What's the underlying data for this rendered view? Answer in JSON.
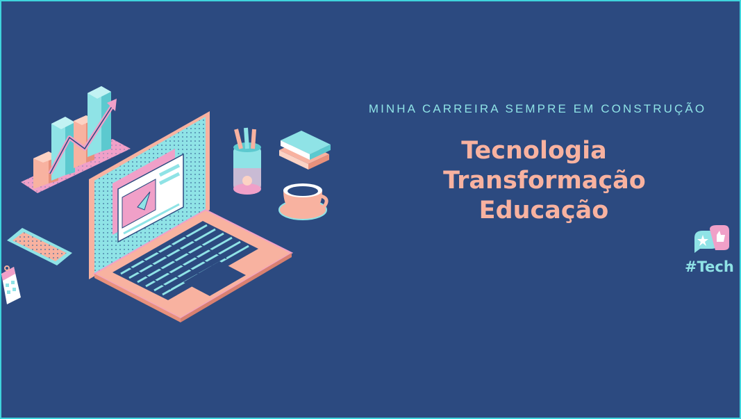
{
  "banner": {
    "tagline": "MINHA CARREIRA SEMPRE EM CONSTRUÇÃO",
    "headings": [
      "Tecnologia",
      "Transformação",
      "Educação"
    ],
    "hashtag": "#Tech"
  },
  "illustration": {
    "items": [
      "bar-chart-icon",
      "laptop-icon",
      "pencil-cup-icon",
      "books-icon",
      "coffee-cup-icon",
      "smartphone-icon",
      "calendar-icon",
      "like-star-icon"
    ]
  },
  "colors": {
    "background": "#2c4a80",
    "border": "#3fd4dc",
    "accent_salmon": "#f8b2a0",
    "accent_cyan": "#8fe3e6",
    "accent_pink": "#f0a0c8"
  }
}
